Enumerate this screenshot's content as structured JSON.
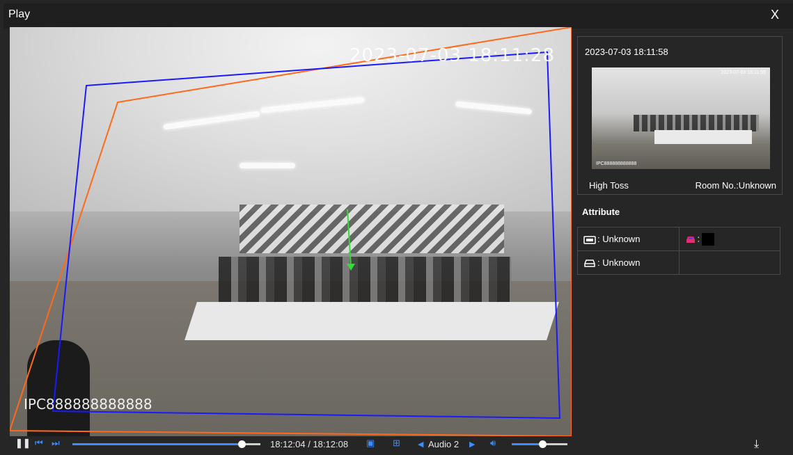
{
  "window": {
    "title": "Play",
    "close_label": "X"
  },
  "video": {
    "timestamp": "2023-07-03 18:11:28",
    "camera_name": "IPC888888888888"
  },
  "controls": {
    "time": "18:12:04 / 18:12:08",
    "audio_label": "Audio 2",
    "progress_fraction": 0.9,
    "volume_fraction": 0.55
  },
  "event": {
    "time": "2023-07-03 18:11:58",
    "thumb_timestamp": "2023-07-03 18:11:55",
    "thumb_camera": "IPC888888888888",
    "type": "High Toss",
    "room": "Room No.:Unknown"
  },
  "attribute": {
    "title": "Attribute",
    "plate": ": Unknown",
    "vehicle": ": Unknown",
    "color_label": ":",
    "color_value": "#000000"
  },
  "colors": {
    "accent": "#3c8cff",
    "rule_orange": "#ff6a1a",
    "rule_blue": "#1a1aff",
    "track_green": "#33dd33",
    "car_icon": "#e0306a"
  },
  "icons": {
    "pause": "pause-icon",
    "prev": "prev-frame-icon",
    "next": "next-frame-icon",
    "rule": "rule-overlay-icon",
    "fit": "fit-window-icon",
    "audio_prev": "triangle-left-icon",
    "audio_next": "triangle-right-icon",
    "volume": "volume-icon",
    "download": "download-icon",
    "plate": "license-plate-icon",
    "car_color": "car-color-icon",
    "vehicle": "car-icon"
  }
}
